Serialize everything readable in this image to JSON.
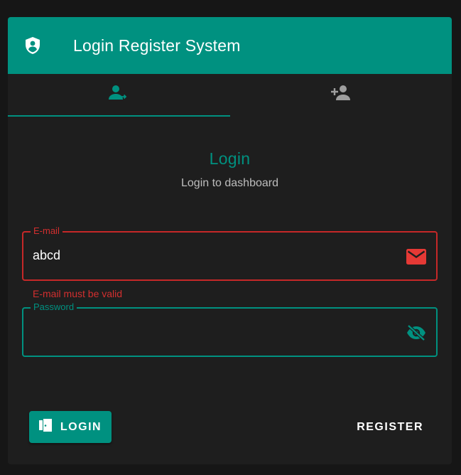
{
  "app": {
    "title": "Login Register System",
    "icon": "shield-account-icon"
  },
  "tabs": [
    {
      "icon": "account-login-icon",
      "active": true
    },
    {
      "icon": "account-plus-icon",
      "active": false
    }
  ],
  "form": {
    "title": "Login",
    "subtitle": "Login to dashboard",
    "email": {
      "label": "E-mail",
      "value": "abcd",
      "icon": "email-icon",
      "error": "E-mail must be valid"
    },
    "password": {
      "label": "Password",
      "value": "",
      "icon": "eye-off-icon"
    },
    "login_button": {
      "label": "LOGIN",
      "icon": "door-icon"
    },
    "register_button": {
      "label": "REGISTER"
    }
  },
  "colors": {
    "primary": "#009180",
    "error": "#d32f2f",
    "surface": "#1e1e1e",
    "background": "#161616"
  }
}
